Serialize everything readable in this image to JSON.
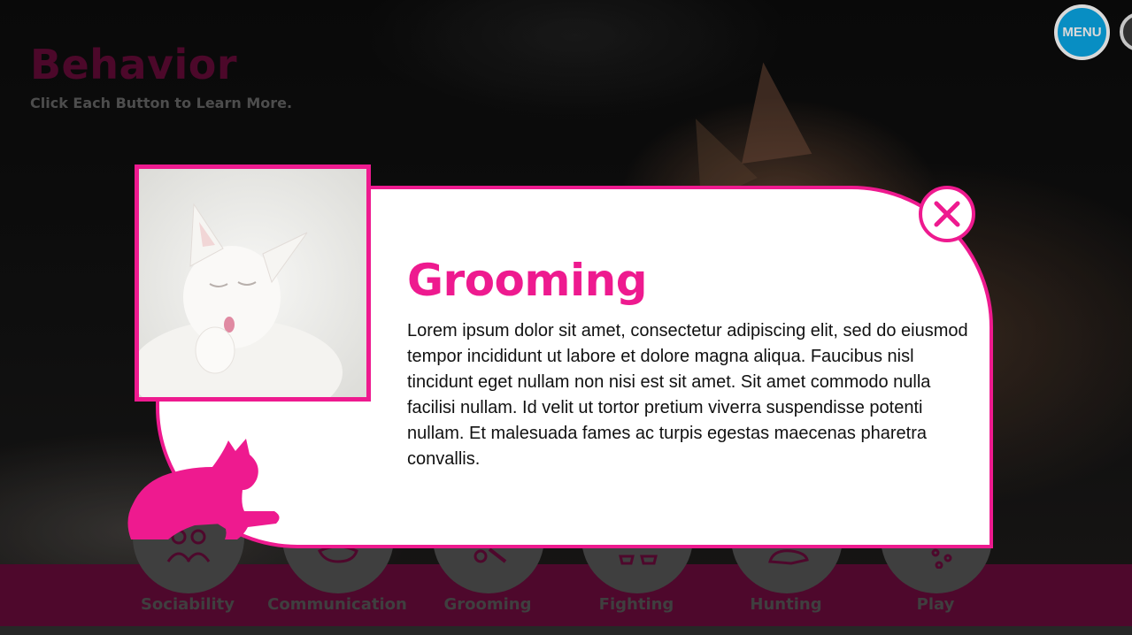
{
  "header": {
    "title": "Behavior",
    "subtitle": "Click Each Button to Learn More."
  },
  "top_controls": {
    "menu_label": "MENU"
  },
  "nav": {
    "items": [
      {
        "label": "Sociability",
        "icon": "people-icon"
      },
      {
        "label": "Communication",
        "icon": "speech-icon"
      },
      {
        "label": "Grooming",
        "icon": "brush-icon"
      },
      {
        "label": "Fighting",
        "icon": "claw-icon"
      },
      {
        "label": "Hunting",
        "icon": "mouse-icon"
      },
      {
        "label": "Play",
        "icon": "yarn-icon"
      }
    ]
  },
  "modal": {
    "heading": "Grooming",
    "body": "Lorem ipsum dolor sit amet, consectetur adipiscing elit, sed do eiusmod tempor incididunt ut labore et dolore magna aliqua. Faucibus nisl tincidunt eget nullam non nisi est sit amet. Sit amet commodo nulla facilisi nullam. Id velit ut tortor pretium viverra suspendisse potenti nullam. Et malesuada fames ac turpis egestas maecenas pharetra convallis.",
    "image": "white-cat-licking-paw-photo",
    "decoration": "pink-cat-silhouette"
  },
  "colors": {
    "accent_pink": "#ee1a8f",
    "menu_blue": "#0aa7e6",
    "nav_bar": "#5c0a34",
    "title_dark": "#5a0a32"
  }
}
